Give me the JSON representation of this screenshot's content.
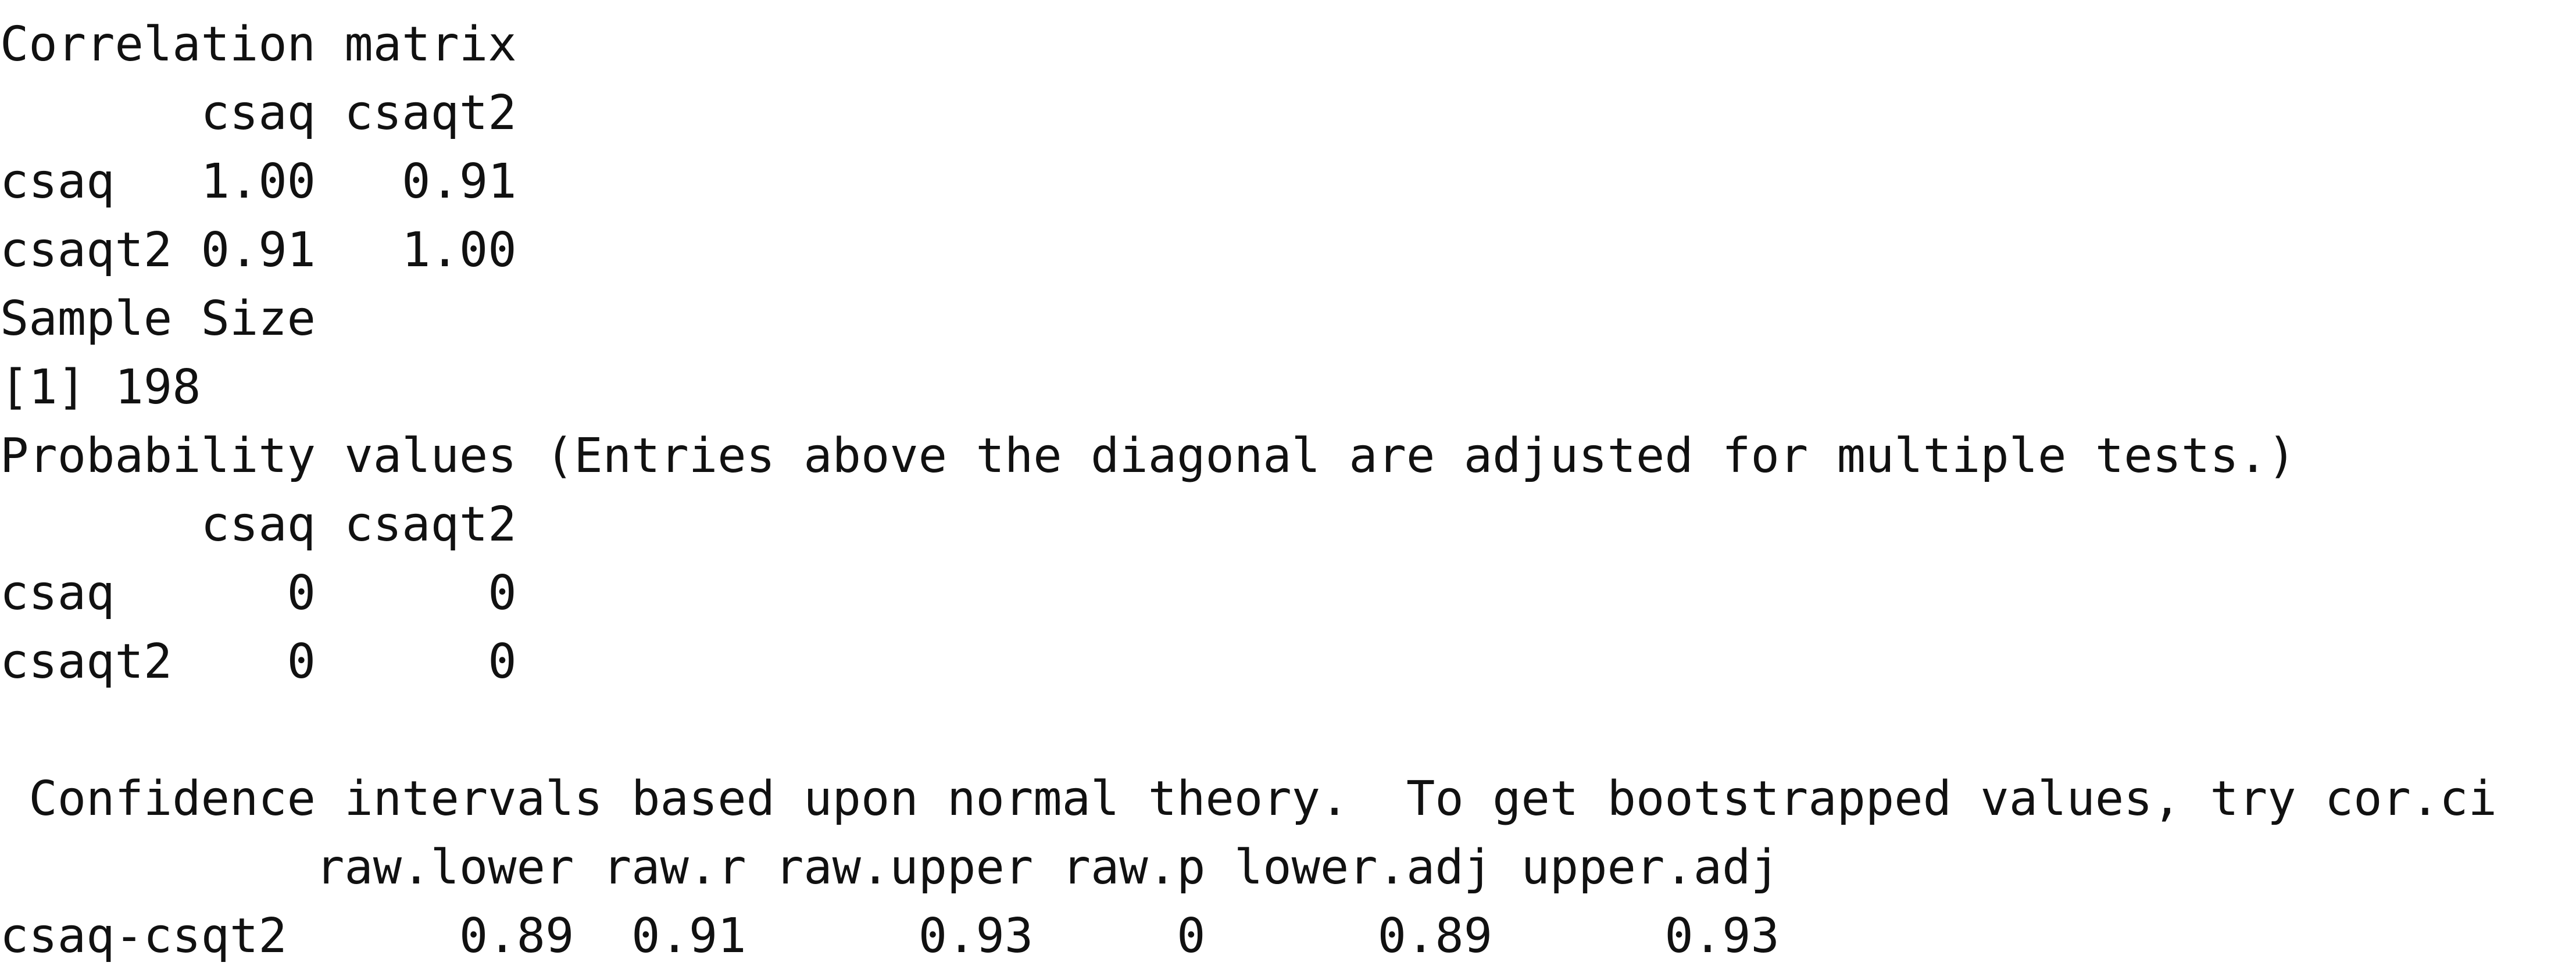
{
  "console": {
    "lines": [
      "Correlation matrix",
      "       csaq csaqt2",
      "csaq   1.00   0.91",
      "csaqt2 0.91   1.00",
      "Sample Size",
      "[1] 198",
      "Probability values (Entries above the diagonal are adjusted for multiple tests.)",
      "       csaq csaqt2",
      "csaq      0      0",
      "csaqt2    0      0",
      "",
      " Confidence intervals based upon normal theory.  To get bootstrapped values, try cor.ci",
      "           raw.lower raw.r raw.upper raw.p lower.adj upper.adj",
      "csaq-csqt2      0.89  0.91      0.93     0      0.89      0.93"
    ]
  }
}
